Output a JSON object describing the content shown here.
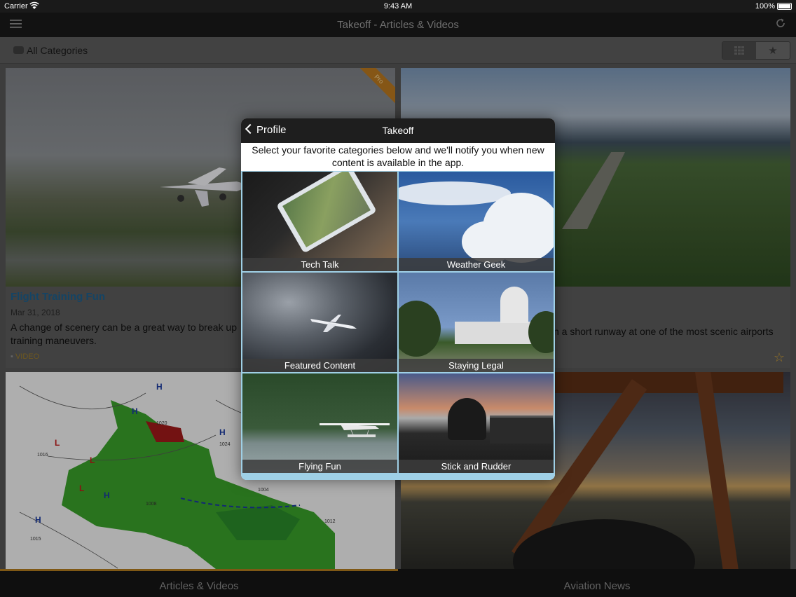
{
  "status_bar": {
    "carrier": "Carrier",
    "time": "9:43 AM",
    "battery": "100%"
  },
  "nav": {
    "title": "Takeoff - Articles & Videos"
  },
  "filter": {
    "category_label": "All Categories"
  },
  "feed": {
    "card1": {
      "ribbon": "Pro",
      "headline": "Flight Training Fun",
      "date": "Mar 31, 2018",
      "summary": "A change of scenery can be a great way to break up",
      "summary_line2": "training maneuvers.",
      "tag": "VIDEO"
    },
    "card2": {
      "summary": "n a short runway at one of the most scenic airports"
    },
    "card3": {
      "map_labels": [
        "H",
        "H",
        "H",
        "H",
        "H",
        "L",
        "L",
        "L",
        "1024",
        "1016",
        "1012",
        "1015",
        "1008",
        "1020",
        "1004"
      ]
    }
  },
  "modal": {
    "back_label": "Profile",
    "title": "Takeoff",
    "intro": "Select your favorite categories below and we'll notify you when new content is available in the app.",
    "tiles": [
      {
        "label": "Tech Talk"
      },
      {
        "label": "Weather Geek"
      },
      {
        "label": "Featured Content"
      },
      {
        "label": "Staying Legal"
      },
      {
        "label": "Flying Fun"
      },
      {
        "label": "Stick and Rudder"
      }
    ]
  },
  "tabs": [
    {
      "label": "Articles & Videos",
      "active": true
    },
    {
      "label": "Aviation News",
      "active": false
    }
  ],
  "colors": {
    "accent": "#b07a1e",
    "link": "#1d5f8c",
    "star": "#c89a38"
  }
}
